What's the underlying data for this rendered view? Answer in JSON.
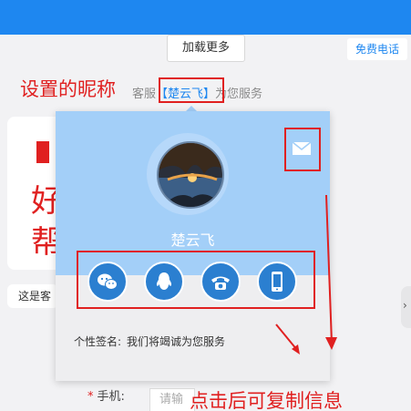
{
  "header": {
    "load_more_label": "加载更多",
    "free_call_label": "免费电话"
  },
  "annotations": {
    "nickname_note": "设置的昵称",
    "copy_note": "点击后可复制信息"
  },
  "service_line": {
    "prefix": "客服",
    "nickname": "【楚云飞】",
    "suffix": "为您服务"
  },
  "background": {
    "card_line1": "好",
    "card_line2": "帮",
    "message_preview": "这是客"
  },
  "form": {
    "phone_label": "手机:",
    "phone_placeholder": "请输",
    "required_mark": "*"
  },
  "side_tab_glyph": "›",
  "popup": {
    "nickname": "楚云飞",
    "signature_label": "个性签名:",
    "signature_text": "我们将竭诚为您服务",
    "contact_icons": [
      "wechat-icon",
      "qq-icon",
      "telephone-icon",
      "mobile-phone-icon"
    ],
    "mail_icon": "mail-icon"
  },
  "colors": {
    "accent": "#1e87f0",
    "annotation": "#e02020",
    "popup_header": "#a3cff8",
    "contact_button": "#2b7fd0"
  }
}
